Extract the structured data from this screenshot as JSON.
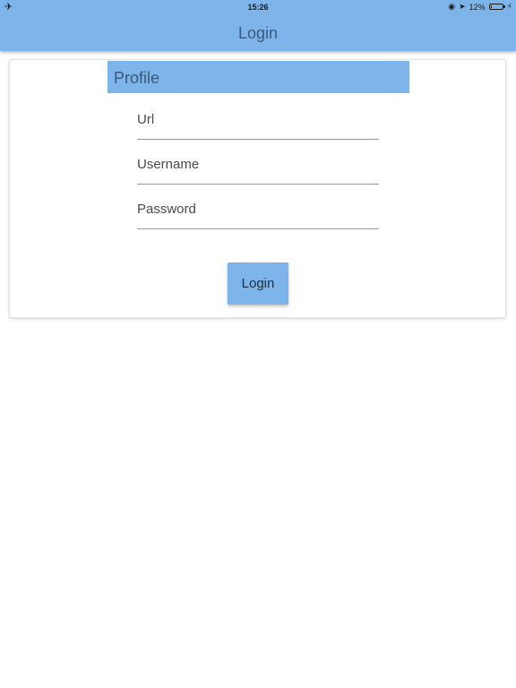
{
  "status_bar": {
    "left_icon": "airplane-icon",
    "time": "15:26",
    "battery_percent": "12%",
    "battery_level": 0.12,
    "icons": [
      "orientation-lock-icon",
      "location-arrow-icon",
      "battery-icon",
      "charging-bolt-icon"
    ]
  },
  "app_bar": {
    "title": "Login"
  },
  "profile": {
    "header": "Profile",
    "fields": {
      "url": {
        "placeholder": "Url",
        "value": ""
      },
      "username": {
        "placeholder": "Username",
        "value": ""
      },
      "password": {
        "placeholder": "Password",
        "value": ""
      }
    },
    "login_button": "Login"
  },
  "colors": {
    "accent": "#7db4ea",
    "title_text": "#3c5a78"
  }
}
